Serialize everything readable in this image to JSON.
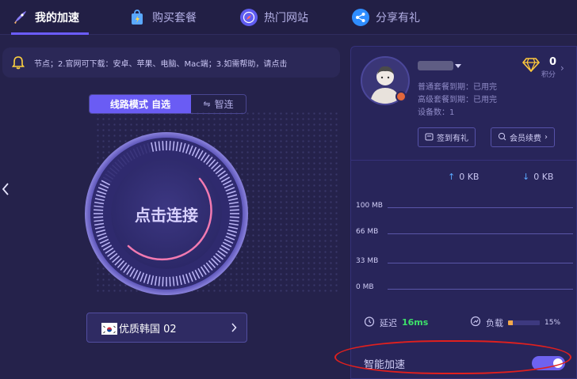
{
  "nav": {
    "tabs": [
      {
        "label": "我的加速",
        "icon": "rocket-icon",
        "active": true
      },
      {
        "label": "购买套餐",
        "icon": "shopping-bag-icon",
        "active": false
      },
      {
        "label": "热门网站",
        "icon": "compass-icon",
        "active": false
      },
      {
        "label": "分享有礼",
        "icon": "share-icon",
        "active": false
      }
    ]
  },
  "notice": {
    "text": "节点；2.官网可下载：安卓、苹果、电脑、Mac端；3.如需帮助，请点击"
  },
  "mode": {
    "selected_label": "线路模式 自选",
    "alt_label": "智连"
  },
  "connect": {
    "label": "点击连接"
  },
  "server": {
    "name": "优质韩国 02",
    "flag": "south-korea-flag-icon"
  },
  "user": {
    "normal_plan": "普通套餐到期：已用完",
    "advanced_plan": "高级套餐到期：已用完",
    "devices": "设备数：1",
    "points_value": "0",
    "points_label": "积分",
    "checkin_label": "签到有礼",
    "renew_label": "会员续费"
  },
  "traffic": {
    "upload": "0 KB",
    "download": "0 KB"
  },
  "chart_data": {
    "type": "line",
    "y_ticks": [
      "100 MB",
      "66 MB",
      "33 MB",
      "0 MB"
    ],
    "ylim": [
      0,
      100
    ],
    "series": []
  },
  "stats": {
    "latency_label": "延迟",
    "latency_value": "16ms",
    "load_label": "负载",
    "load_value": "15%",
    "load_fraction": 0.15
  },
  "smart": {
    "label": "智能加速",
    "enabled": true
  },
  "colors": {
    "accent": "#6a5cf4",
    "latency_green": "#3de06a",
    "load_orange": "#f5a94b",
    "annotation_red": "#e0201e"
  }
}
